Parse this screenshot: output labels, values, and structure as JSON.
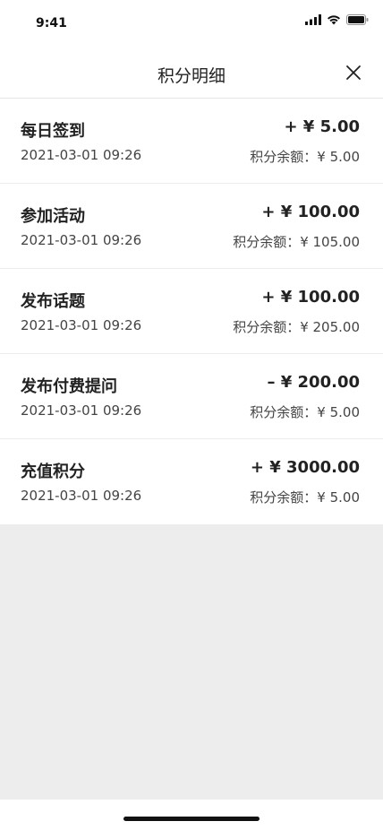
{
  "status_bar": {
    "time": "9:41"
  },
  "nav": {
    "title": "积分明细",
    "close_icon": "close-icon"
  },
  "records": [
    {
      "title": "每日签到",
      "date": "2021-03-01 09:26",
      "amount": "+ ¥ 5.00",
      "balance": "积分余额：¥ 5.00"
    },
    {
      "title": "参加活动",
      "date": "2021-03-01 09:26",
      "amount": "+ ¥ 100.00",
      "balance": "积分余额：¥ 105.00"
    },
    {
      "title": "发布话题",
      "date": "2021-03-01 09:26",
      "amount": "+ ¥ 100.00",
      "balance": "积分余额：¥ 205.00"
    },
    {
      "title": "发布付费提问",
      "date": "2021-03-01 09:26",
      "amount": "– ¥ 200.00",
      "balance": "积分余额：¥ 5.00"
    },
    {
      "title": "充值积分",
      "date": "2021-03-01 09:26",
      "amount": "+ ¥ 3000.00",
      "balance": "积分余额：¥ 5.00"
    }
  ],
  "colors": {
    "background": "#ededed",
    "surface": "#ffffff",
    "text": "#222222",
    "secondary_text": "#444444",
    "divider": "#ececec"
  }
}
